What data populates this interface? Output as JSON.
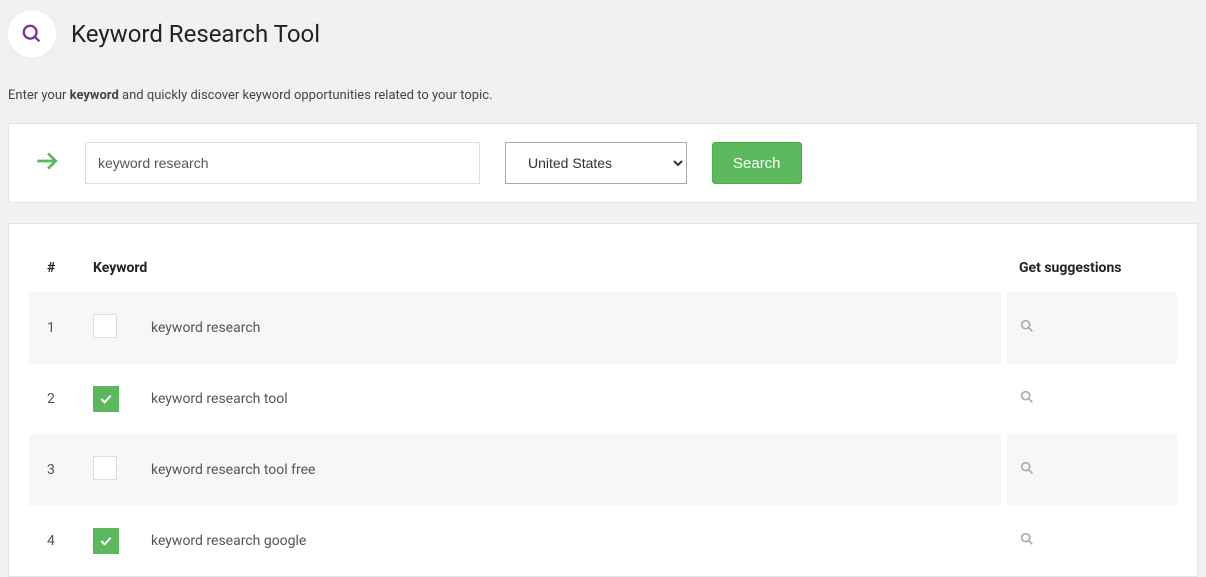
{
  "header": {
    "title": "Keyword Research Tool",
    "description_prefix": "Enter your ",
    "description_bold": "keyword",
    "description_suffix": " and quickly discover keyword opportunities related to your topic."
  },
  "search": {
    "keyword_value": "keyword research",
    "country_value": "United States",
    "button_label": "Search"
  },
  "table": {
    "headers": {
      "num": "#",
      "keyword": "Keyword",
      "suggestions": "Get suggestions"
    },
    "rows": [
      {
        "num": "1",
        "checked": false,
        "keyword": "keyword research"
      },
      {
        "num": "2",
        "checked": true,
        "keyword": "keyword research tool"
      },
      {
        "num": "3",
        "checked": false,
        "keyword": "keyword research tool free"
      },
      {
        "num": "4",
        "checked": true,
        "keyword": "keyword research google"
      }
    ]
  }
}
